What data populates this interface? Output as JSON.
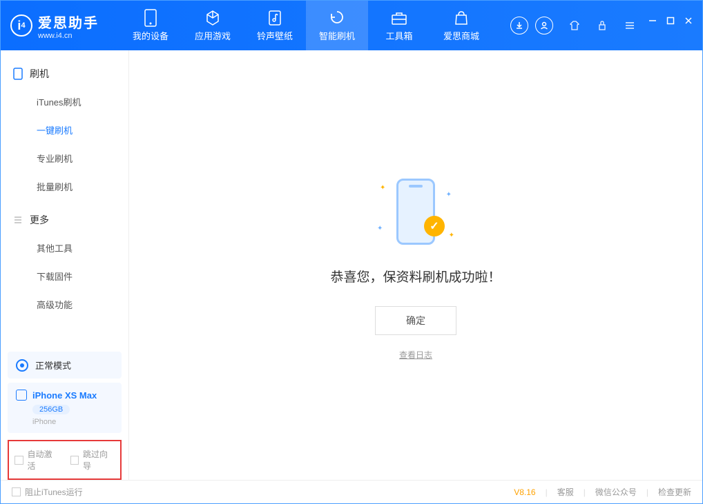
{
  "app": {
    "title": "爱思助手",
    "subtitle": "www.i4.cn"
  },
  "nav": {
    "items": [
      {
        "label": "我的设备"
      },
      {
        "label": "应用游戏"
      },
      {
        "label": "铃声壁纸"
      },
      {
        "label": "智能刷机"
      },
      {
        "label": "工具箱"
      },
      {
        "label": "爱思商城"
      }
    ]
  },
  "sidebar": {
    "group1": {
      "title": "刷机",
      "items": [
        "iTunes刷机",
        "一键刷机",
        "专业刷机",
        "批量刷机"
      ]
    },
    "group2": {
      "title": "更多",
      "items": [
        "其他工具",
        "下载固件",
        "高级功能"
      ]
    },
    "mode": {
      "label": "正常模式"
    },
    "device": {
      "name": "iPhone XS Max",
      "storage": "256GB",
      "type": "iPhone"
    },
    "options": {
      "auto_activate": "自动激活",
      "skip_guide": "跳过向导"
    }
  },
  "main": {
    "success_msg": "恭喜您，保资料刷机成功啦！",
    "ok_label": "确定",
    "log_link": "查看日志"
  },
  "footer": {
    "block_itunes": "阻止iTunes运行",
    "version": "V8.16",
    "links": [
      "客服",
      "微信公众号",
      "检查更新"
    ]
  }
}
